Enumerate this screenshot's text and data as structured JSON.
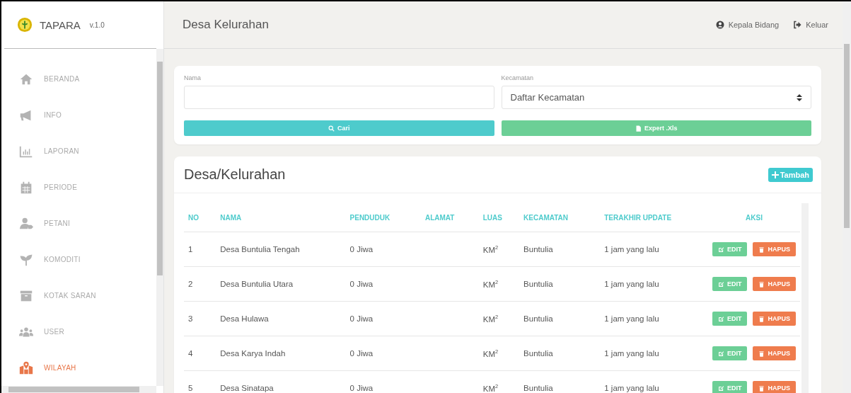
{
  "app": {
    "name": "TAPARA",
    "version": "v.1.0"
  },
  "sidebar": {
    "items": [
      {
        "label": "BERANDA",
        "selected": false
      },
      {
        "label": "INFO",
        "selected": false
      },
      {
        "label": "LAPORAN",
        "selected": false
      },
      {
        "label": "PERIODE",
        "selected": false
      },
      {
        "label": "PETANI",
        "selected": false
      },
      {
        "label": "KOMODITI",
        "selected": false
      },
      {
        "label": "KOTAK SARAN",
        "selected": false
      },
      {
        "label": "USER",
        "selected": false
      },
      {
        "label": "WILAYAH",
        "selected": true
      }
    ]
  },
  "header": {
    "title": "Desa Kelurahan",
    "user": "Kepala Bidang",
    "logout": "Keluar"
  },
  "filter": {
    "name_label": "Nama",
    "district_label": "Kecamatan",
    "district_value": "Daftar Kecamatan",
    "search_button": "Cari",
    "export_button": "Expert .Xls"
  },
  "table": {
    "title": "Desa/Kelurahan",
    "add_button": "Tambah",
    "columns": [
      "NO",
      "NAMA",
      "PENDUDUK",
      "ALAMAT",
      "LUAS",
      "KECAMATAN",
      "TERAKHIR UPDATE",
      "AKSI"
    ],
    "rows": [
      {
        "no": "1",
        "name": "Desa Buntulia Tengah",
        "population": "0 Jiwa",
        "address": "",
        "area": "KM$^{2}$",
        "district": "Buntulia",
        "updated": "1 jam yang lalu",
        "edit": "EDIT",
        "delete": "HAPUS"
      },
      {
        "no": "2",
        "name": "Desa Buntulia Utara",
        "population": "0 Jiwa",
        "address": "",
        "area": "KM$^{2}$",
        "district": "Buntulia",
        "updated": "1 jam yang lalu",
        "edit": "EDIT",
        "delete": "HAPUS"
      },
      {
        "no": "3",
        "name": "Desa Hulawa",
        "population": "0 Jiwa",
        "address": "",
        "area": "KM$^{2}$",
        "district": "Buntulia",
        "updated": "1 jam yang lalu",
        "edit": "EDIT",
        "delete": "HAPUS"
      },
      {
        "no": "4",
        "name": "Desa Karya Indah",
        "population": "0 Jiwa",
        "address": "",
        "area": "KM$^{2}$",
        "district": "Buntulia",
        "updated": "1 jam yang lalu",
        "edit": "EDIT",
        "delete": "HAPUS"
      },
      {
        "no": "5",
        "name": "Desa Sinatapa",
        "population": "0 Jiwa",
        "address": "",
        "area": "KM$^{2}$",
        "district": "Buntulia",
        "updated": "1 jam yang lalu",
        "edit": "EDIT",
        "delete": "HAPUS"
      }
    ]
  }
}
